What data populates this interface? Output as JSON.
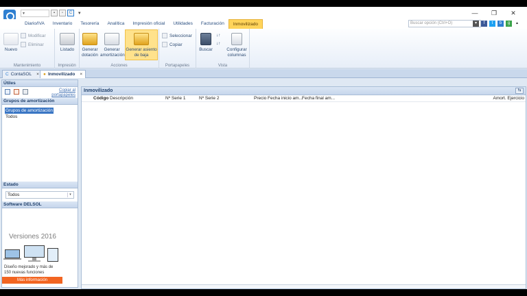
{
  "titlebar": {
    "window_controls": [
      "—",
      "❐",
      "✕"
    ]
  },
  "ribbon_tabs": [
    {
      "label": "Diario/IVA"
    },
    {
      "label": "Inventario"
    },
    {
      "label": "Tesorería"
    },
    {
      "label": "Analítica"
    },
    {
      "label": "Impresión oficial"
    },
    {
      "label": "Utilidades"
    },
    {
      "label": "Facturación"
    },
    {
      "label": "Inmovilizado",
      "active": true
    }
  ],
  "search": {
    "placeholder": "Buscar opción (Ctrl+O)"
  },
  "ribbon": {
    "mantenimiento": {
      "new": "Nuevo",
      "modify": "Modificar",
      "delete": "Eliminar",
      "label": "Mantenimiento"
    },
    "impresion": {
      "list": "Listado",
      "label": "Impresión"
    },
    "acciones": {
      "gen_dotacion_1": "Generar",
      "gen_dotacion_2": "dotación",
      "gen_amort_1": "Generar",
      "gen_amort_2": "amortización",
      "gen_baja_1": "Generar asiento",
      "gen_baja_2": "de baja",
      "label": "Acciones"
    },
    "portapapeles": {
      "select": "Seleccionar",
      "copy": "Copiar",
      "label": "Portapapeles"
    },
    "vista": {
      "search": "Buscar",
      "config_1": "Configurar",
      "config_2": "columnas",
      "label": "Vista"
    }
  },
  "doc_tabs": [
    {
      "label": "ContaSOL"
    },
    {
      "label": "Inmovilizado"
    }
  ],
  "left": {
    "utiles_title": "Útiles",
    "copy_link_1": "Copiar al",
    "copy_link_2": "portapapeles",
    "groups_title": "Grupos de amortización",
    "groups": [
      {
        "label": "Grupos de amortización",
        "selected": true
      },
      {
        "label": "Todos",
        "selected": false
      }
    ],
    "estado_title": "Estado",
    "estado_value": "Todos",
    "software_title": "Software DELSOL",
    "promo_title": "Versiones 2016",
    "promo_desc_1": "Diseño mejorado y más de",
    "promo_desc_2": "150 nuevas funciones",
    "promo_button": "Más información"
  },
  "main": {
    "title": "Inmovilizado",
    "columns": {
      "codigo": "Código",
      "descripcion": "Descripción",
      "serie1": "Nº Serie 1",
      "serie2": "Nº Serie 2",
      "precio": "Precio",
      "fecha_inicio": "Fecha inicio am...",
      "fecha_final": "Fecha final am...",
      "amort": "Amort. Ejercicio"
    }
  },
  "colors": {
    "accent": "#ffd45a",
    "brand": "#2e7fd1",
    "promo": "#f26522"
  }
}
